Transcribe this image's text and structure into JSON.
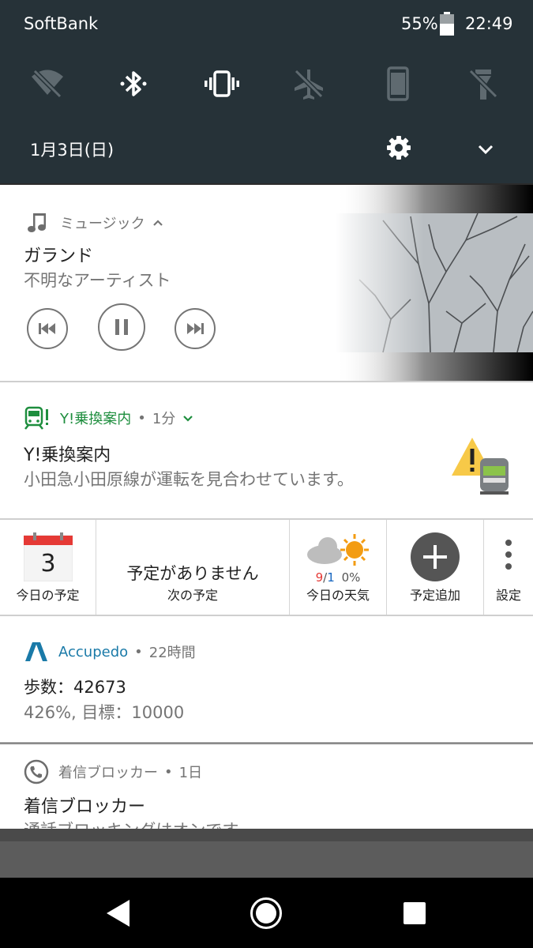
{
  "status_bar": {
    "carrier": "SoftBank",
    "battery_percent": "55%",
    "time": "22:49"
  },
  "quick_settings": {
    "tiles": [
      {
        "icon": "wifi-off-icon",
        "state": "off"
      },
      {
        "icon": "bluetooth-icon",
        "state": "on"
      },
      {
        "icon": "vibrate-icon",
        "state": "on"
      },
      {
        "icon": "airplane-mode-icon",
        "state": "off"
      },
      {
        "icon": "auto-rotate-icon",
        "state": "off"
      },
      {
        "icon": "flashlight-icon",
        "state": "off"
      }
    ],
    "date": "1月3日(日)"
  },
  "music": {
    "app_name": "ミュージック",
    "title": "ガランド",
    "artist": "不明なアーティスト"
  },
  "transit": {
    "app_name": "Y!乗換案内",
    "time": "1分",
    "title": "Y!乗換案内",
    "text": "小田急小田原線が運転を見合わせています。"
  },
  "widget": {
    "calendar_day": "3",
    "calendar_label": "今日の予定",
    "no_events": "予定がありません",
    "next_label": "次の予定",
    "weather_high": "9",
    "weather_sep": "/",
    "weather_low": "1",
    "weather_rain": "0%",
    "weather_label": "今日の天気",
    "add_label": "予定追加",
    "settings_label": "設定"
  },
  "accupedo": {
    "app_name": "Accupedo",
    "time": "22時間",
    "title": "歩数：42673",
    "text": "426%, 目標：10000"
  },
  "blocker": {
    "app_name": "着信ブロッカー",
    "time": "1日",
    "title": "着信ブロッカー",
    "text": "通話ブロッキングはオンです。"
  },
  "colors": {
    "shade_bg": "#263238",
    "transit_green": "#1e8e3e",
    "accupedo_blue": "#1a7aa8",
    "calendar_red": "#e53935",
    "weather_high": "#e53935",
    "weather_low": "#1565c0"
  }
}
